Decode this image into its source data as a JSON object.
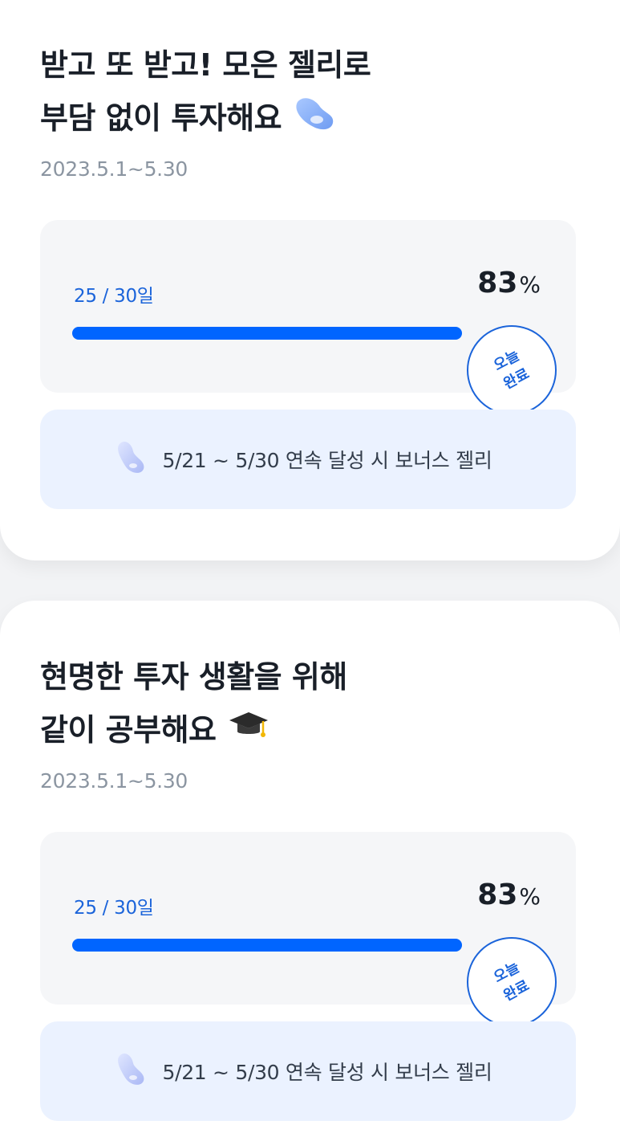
{
  "challenges": [
    {
      "title_line1": "받고 또 받고! 모은 젤리로",
      "title_line2": "부담 없이 투자해요",
      "title_icon": "jelly-bean-icon",
      "period": "2023.5.1~5.30",
      "progress_label": "25 / 30일",
      "progress_percent": "83",
      "percent_sign": "%",
      "progress_fraction": 0.83,
      "stamp_line1": "오늘",
      "stamp_line2": "완료",
      "bonus_icon": "jelly-bean-icon",
      "bonus_text": "5/21 ~ 5/30 연속 달성 시  보너스 젤리"
    },
    {
      "title_line1": "현명한 투자 생활을 위해",
      "title_line2": "같이 공부해요",
      "title_icon": "graduation-cap-icon",
      "period": "2023.5.1~5.30",
      "progress_label": "25 / 30일",
      "progress_percent": "83",
      "percent_sign": "%",
      "progress_fraction": 0.83,
      "stamp_line1": "오늘",
      "stamp_line2": "완료",
      "bonus_icon": "jelly-bean-icon",
      "bonus_text": "5/21 ~ 5/30 연속 달성 시  보너스 젤리"
    }
  ],
  "colors": {
    "accent": "#0065ff",
    "accent_text": "#1b64da",
    "bonus_bg": "#ebf2ff",
    "progress_bg": "#f5f6f8"
  }
}
